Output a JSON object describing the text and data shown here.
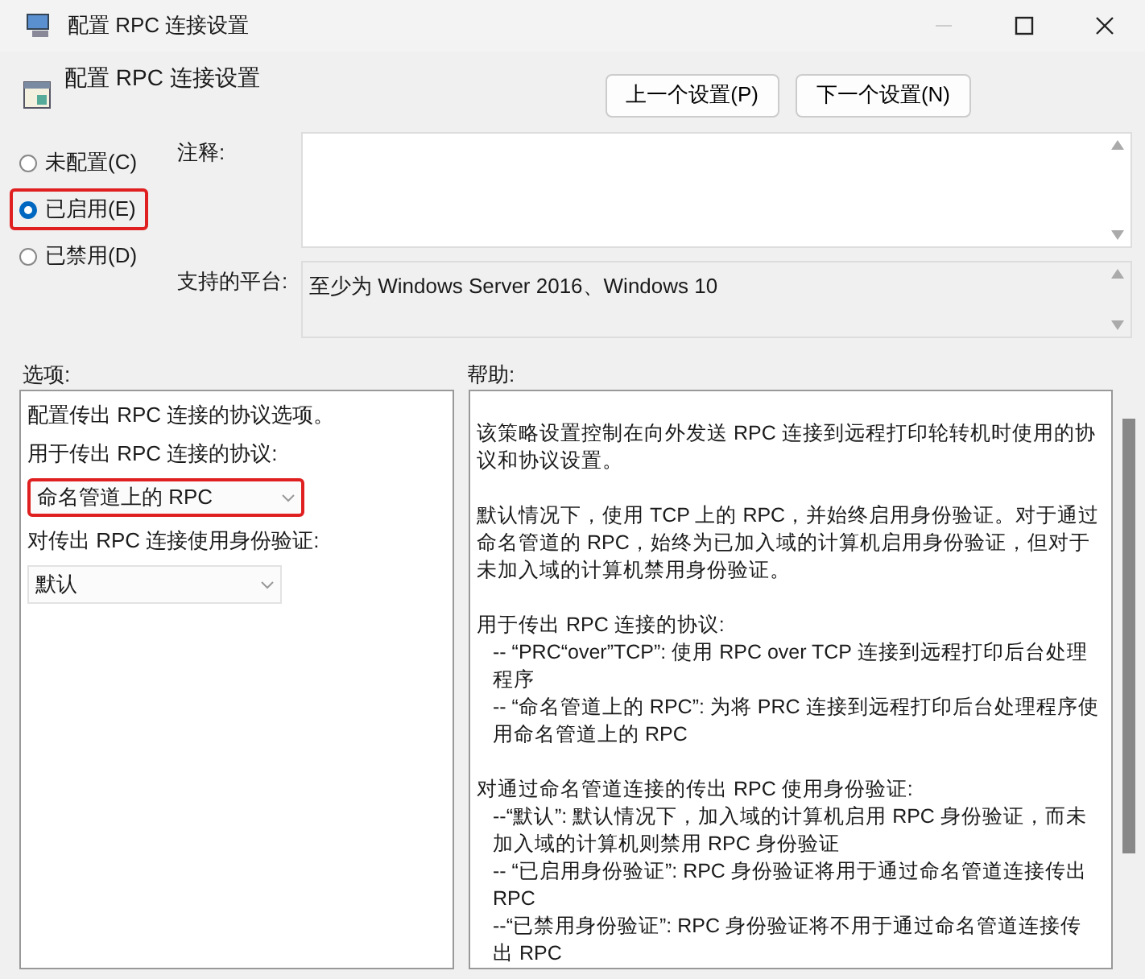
{
  "window": {
    "title": "配置 RPC 连接设置"
  },
  "header": {
    "title": "配置 RPC 连接设置",
    "buttons": [
      "上一个设置(P)",
      "下一个设置(N)"
    ]
  },
  "state_options": [
    {
      "label": "未配置(C)",
      "selected": false,
      "highlighted": false
    },
    {
      "label": "已启用(E)",
      "selected": true,
      "highlighted": true
    },
    {
      "label": "已禁用(D)",
      "selected": false,
      "highlighted": false
    }
  ],
  "comment": {
    "label": "注释:"
  },
  "platform": {
    "label": "支持的平台:",
    "value": "至少为 Windows Server 2016、Windows 10"
  },
  "options": {
    "label": "选项:",
    "description": "配置传出 RPC 连接的协议选项。",
    "fields": [
      {
        "label": "用于传出 RPC 连接的协议:",
        "value": "命名管道上的 RPC",
        "highlighted": true
      },
      {
        "label": "对传出 RPC 连接使用身份验证:",
        "value": "默认",
        "highlighted": false
      }
    ]
  },
  "help": {
    "label": "帮助:",
    "blocks": [
      {
        "kind": "para",
        "text": "该策略设置控制在向外发送 RPC 连接到远程打印轮转机时使用的协议和协议设置。"
      },
      {
        "kind": "gap"
      },
      {
        "kind": "para",
        "text": "默认情况下，使用 TCP 上的 RPC，并始终启用身份验证。对于通过命名管道的 RPC，始终为已加入域的计算机启用身份验证，但对于未加入域的计算机禁用身份验证。"
      },
      {
        "kind": "gap"
      },
      {
        "kind": "para",
        "text": "用于传出 RPC 连接的协议:"
      },
      {
        "kind": "item",
        "text": "-- “PRC“over”TCP”: 使用 RPC over TCP 连接到远程打印后台处理程序"
      },
      {
        "kind": "item",
        "text": "-- “命名管道上的 RPC”: 为将 PRC 连接到远程打印后台处理程序使用命名管道上的 RPC"
      },
      {
        "kind": "gap"
      },
      {
        "kind": "para",
        "text": "对通过命名管道连接的传出 RPC 使用身份验证:"
      },
      {
        "kind": "item",
        "text": "--“默认”: 默认情况下，加入域的计算机启用 RPC 身份验证，而未加入域的计算机则禁用 RPC 身份验证"
      },
      {
        "kind": "item",
        "text": "-- “已启用身份验证”: RPC 身份验证将用于通过命名管道连接传出 RPC"
      },
      {
        "kind": "item",
        "text": "--“已禁用身份验证”: RPC 身份验证将不用于通过命名管道连接传出 RPC"
      }
    ]
  }
}
